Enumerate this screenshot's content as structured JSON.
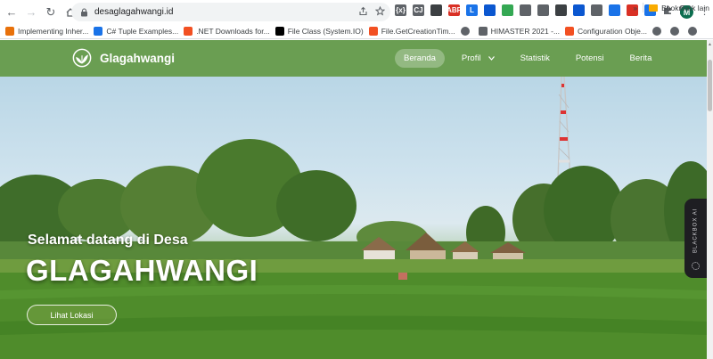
{
  "browser": {
    "url": "desaglagahwangi.id",
    "profile_initial": "M",
    "extensions": [
      {
        "name": "css-ext",
        "label": "{x}",
        "color": "#5f6368"
      },
      {
        "name": "cj-ext",
        "label": "CJ",
        "color": "#5f6368"
      },
      {
        "name": "cloud-ext",
        "label": "",
        "color": "#3c4043"
      },
      {
        "name": "abp-ext",
        "label": "ABP",
        "color": "#d93025"
      },
      {
        "name": "l-ext",
        "label": "L",
        "color": "#1a73e8"
      },
      {
        "name": "lens-ext",
        "label": "",
        "color": "#0b57d0"
      },
      {
        "name": "box-ext",
        "label": "",
        "color": "#34a853"
      },
      {
        "name": "camera-ext",
        "label": "",
        "color": "#5f6368"
      },
      {
        "name": "image-ext",
        "label": "",
        "color": "#5f6368"
      },
      {
        "name": "shield-ext",
        "label": "",
        "color": "#3c4043"
      },
      {
        "name": "dot-ext",
        "label": "",
        "color": "#0b57d0"
      },
      {
        "name": "dots-ext",
        "label": "",
        "color": "#5f6368"
      },
      {
        "name": "scan-ext",
        "label": "",
        "color": "#1a73e8"
      },
      {
        "name": "red-ext",
        "label": "",
        "color": "#d93025"
      },
      {
        "name": "doc-ext",
        "label": "",
        "color": "#1a73e8"
      }
    ]
  },
  "bookmarks": {
    "items": [
      {
        "label": "Implementing Inher...",
        "color": "#e8710a"
      },
      {
        "label": "C# Tuple Examples...",
        "color": "#1a73e8"
      },
      {
        "label": ".NET Downloads for...",
        "color": "#f25022"
      },
      {
        "label": "File Class (System.IO)",
        "color": "#000000"
      },
      {
        "label": "File.GetCreationTim...",
        "color": "#f25022"
      },
      {
        "label": "",
        "color": "#5f6368"
      },
      {
        "label": "HIMASTER 2021 -...",
        "color": "#5f6368"
      },
      {
        "label": "Configuration Obje...",
        "color": "#f25022"
      },
      {
        "label": "",
        "color": "#5f6368"
      },
      {
        "label": "",
        "color": "#5f6368"
      },
      {
        "label": "",
        "color": "#5f6368"
      }
    ],
    "overflow": "»",
    "other_label": "Bookmark lain"
  },
  "site": {
    "brand": "Glagahwangi",
    "nav": [
      {
        "label": "Beranda",
        "active": true,
        "dropdown": false
      },
      {
        "label": "Profil",
        "active": false,
        "dropdown": true
      },
      {
        "label": "Statistik",
        "active": false,
        "dropdown": false
      },
      {
        "label": "Potensi",
        "active": false,
        "dropdown": false
      },
      {
        "label": "Berita",
        "active": false,
        "dropdown": false
      }
    ],
    "hero": {
      "welcome": "Selamat datang di Desa",
      "heading": "GLAGAHWANGI",
      "button": "Lihat Lokasi"
    },
    "navbar_color": "#6a9e52"
  },
  "blackbox": {
    "label": "BLACKBOX AI"
  }
}
